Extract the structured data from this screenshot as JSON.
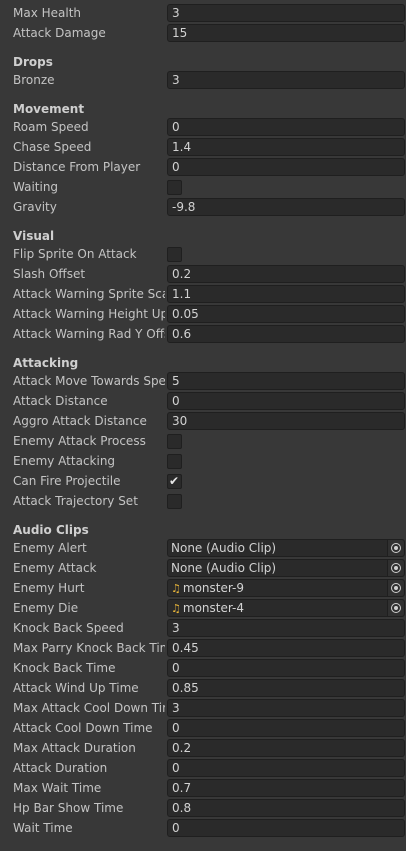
{
  "stats": {
    "max_health": {
      "label": "Max Health",
      "value": "3"
    },
    "attack_damage": {
      "label": "Attack Damage",
      "value": "15"
    }
  },
  "drops": {
    "header": "Drops",
    "bronze": {
      "label": "Bronze",
      "value": "3"
    }
  },
  "movement": {
    "header": "Movement",
    "roam_speed": {
      "label": "Roam Speed",
      "value": "0"
    },
    "chase_speed": {
      "label": "Chase Speed",
      "value": "1.4"
    },
    "distance_from_player": {
      "label": "Distance From Player",
      "value": "0"
    },
    "waiting": {
      "label": "Waiting",
      "checked": false
    },
    "gravity": {
      "label": "Gravity",
      "value": "-9.8"
    }
  },
  "visual": {
    "header": "Visual",
    "flip_sprite_on_attack": {
      "label": "Flip Sprite On Attack",
      "checked": false
    },
    "slash_offset": {
      "label": "Slash Offset",
      "value": "0.2"
    },
    "attack_warning_sprite_scale": {
      "label": "Attack Warning Sprite Scale",
      "value": "1.1"
    },
    "attack_warning_height_up": {
      "label": "Attack Warning Height Up",
      "value": "0.05"
    },
    "attack_warning_rad_y_offset": {
      "label": "Attack Warning Rad Y Offset",
      "value": "0.6"
    }
  },
  "attacking": {
    "header": "Attacking",
    "attack_move_towards_speed": {
      "label": "Attack Move Towards Speed",
      "value": "5"
    },
    "attack_distance": {
      "label": "Attack Distance",
      "value": "0"
    },
    "aggro_attack_distance": {
      "label": "Aggro Attack Distance",
      "value": "30"
    },
    "enemy_attack_process": {
      "label": "Enemy Attack Process",
      "checked": false
    },
    "enemy_attacking": {
      "label": "Enemy Attacking",
      "checked": false
    },
    "can_fire_projectile": {
      "label": "Can Fire Projectile",
      "checked": true,
      "tick": "✔"
    },
    "attack_trajectory_set": {
      "label": "Attack Trajectory Set",
      "checked": false
    }
  },
  "audio": {
    "header": "Audio Clips",
    "enemy_alert": {
      "label": "Enemy Alert",
      "value": "None (Audio Clip)"
    },
    "enemy_attack": {
      "label": "Enemy Attack",
      "value": "None (Audio Clip)"
    },
    "enemy_hurt": {
      "label": "Enemy Hurt",
      "value": "monster-9",
      "icon": "♫"
    },
    "enemy_die": {
      "label": "Enemy Die",
      "value": "monster-4",
      "icon": "♫"
    }
  },
  "timing": {
    "knock_back_speed": {
      "label": "Knock Back Speed",
      "value": "3"
    },
    "max_parry_knock_back_time": {
      "label": "Max Parry Knock Back Time",
      "value": "0.45"
    },
    "knock_back_time": {
      "label": "Knock Back Time",
      "value": "0"
    },
    "attack_wind_up_time": {
      "label": "Attack Wind Up Time",
      "value": "0.85"
    },
    "max_attack_cool_down_time": {
      "label": "Max Attack Cool Down Time",
      "value": "3"
    },
    "attack_cool_down_time": {
      "label": "Attack Cool Down Time",
      "value": "0"
    },
    "max_attack_duration": {
      "label": "Max Attack Duration",
      "value": "0.2"
    },
    "attack_duration": {
      "label": "Attack Duration",
      "value": "0"
    },
    "max_wait_time": {
      "label": "Max Wait Time",
      "value": "0.7"
    },
    "hp_bar_show_time": {
      "label": "Hp Bar Show Time",
      "value": "0.8"
    },
    "wait_time": {
      "label": "Wait Time",
      "value": "0"
    }
  },
  "colors": {
    "background": "#383838",
    "field_bg": "#2a2a2a",
    "audio_icon": "#e8b53a"
  }
}
